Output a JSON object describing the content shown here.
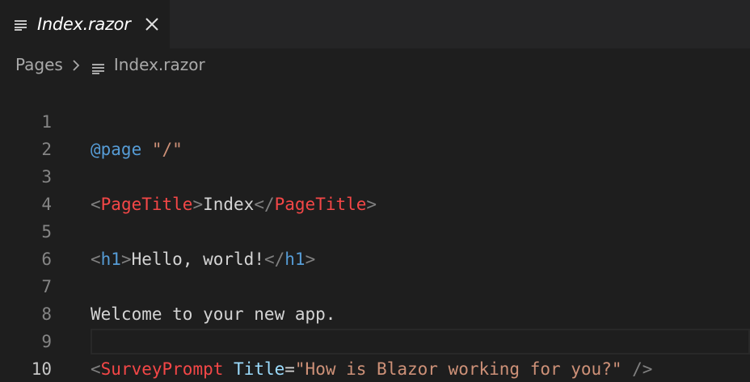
{
  "tab": {
    "label": "Index.razor",
    "file_icon": "file-lines-icon",
    "close_icon": "close-icon"
  },
  "breadcrumb": {
    "folder": "Pages",
    "separator_icon": "chevron-right-icon",
    "file": "Index.razor"
  },
  "editor": {
    "active_line": 10,
    "line_numbers": [
      "1",
      "2",
      "3",
      "4",
      "5",
      "6",
      "7",
      "8",
      "9",
      "10"
    ],
    "lines": {
      "l1": {
        "directive": "@page",
        "space": " ",
        "route": "\"/\""
      },
      "l3": {
        "open_lt": "<",
        "open_tag": "PageTitle",
        "open_gt": ">",
        "text": "Index",
        "close_lt": "</",
        "close_tag": "PageTitle",
        "close_gt": ">"
      },
      "l5": {
        "open_lt": "<",
        "open_tag": "h1",
        "open_gt": ">",
        "text": "Hello, world!",
        "close_lt": "</",
        "close_tag": "h1",
        "close_gt": ">"
      },
      "l7": {
        "text": "Welcome to your new app."
      },
      "l9": {
        "lt": "<",
        "tag": "SurveyPrompt",
        "space": " ",
        "attr": "Title",
        "eq": "=",
        "value": "\"How is Blazor working for you?\"",
        "space2": " ",
        "end": "/>"
      }
    }
  },
  "colors": {
    "background": "#1e1e1e",
    "tabbar": "#252526",
    "keyword": "#569cd6",
    "string": "#ce9178",
    "component_tag": "#f44747",
    "bracket": "#808080",
    "attribute": "#9cdcfe"
  }
}
